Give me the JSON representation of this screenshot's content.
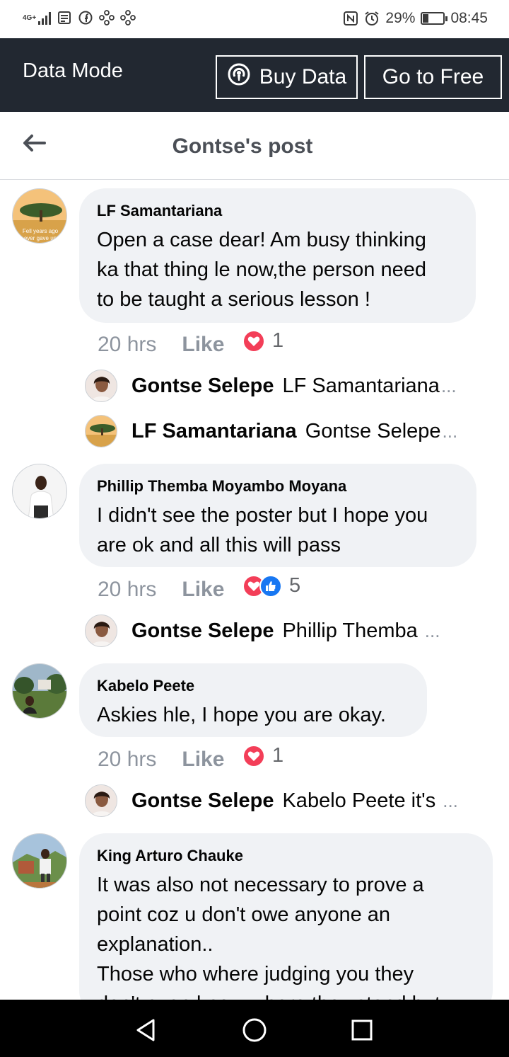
{
  "status_bar": {
    "network": "4G+",
    "battery": "29%",
    "battery_level": 0.29,
    "time": "08:45"
  },
  "data_bar": {
    "title": "Data Mode",
    "buy_label": "Buy Data",
    "free_label": "Go to Free"
  },
  "header": {
    "title": "Gontse's post"
  },
  "comments": [
    {
      "author": "LF Samantariana",
      "text": "Open a case dear! Am busy thinking\nka that thing le now,the person need\nto be taught a serious lesson !",
      "time": "20 hrs",
      "like": "Like",
      "reaction_count": "1",
      "avatar_text": "Fell years ago\never gave up",
      "replies": [
        {
          "name": "Gontse Selepe",
          "text": "LF Samantariana",
          "ellipsis": "..."
        },
        {
          "name": "LF Samantariana",
          "text": "Gontse Selepe",
          "ellipsis": "..."
        }
      ]
    },
    {
      "author": "Phillip Themba Moyambo Moyana",
      "text": "I didn't see the poster but I hope you\nare ok and all this will pass",
      "time": "20 hrs",
      "like": "Like",
      "reaction_count": "5",
      "replies": [
        {
          "name": "Gontse Selepe",
          "text": "Phillip Themba",
          "ellipsis": "..."
        }
      ]
    },
    {
      "author": "Kabelo Peete",
      "text": "Askies hle, I hope you are okay.",
      "time": "20 hrs",
      "like": "Like",
      "reaction_count": "1",
      "replies": [
        {
          "name": "Gontse Selepe",
          "text": "Kabelo Peete it's",
          "ellipsis": "..."
        }
      ]
    },
    {
      "author": "King Arturo Chauke",
      "text": "It was also not necessary to prove a\npoint coz u don't owe anyone an\nexplanation..\nThose who where judging you they\ndon't even know where they stand but"
    }
  ],
  "colors": {
    "data_bar": "#222831",
    "bubble": "#f0f2f5",
    "heart": "#f33e58",
    "like_blue": "#1877f2",
    "meta_gray": "#8d949e"
  },
  "icons": {
    "back": "arrow-left-icon",
    "buy": "broadcast-icon",
    "nav": [
      "back-triangle-icon",
      "home-circle-icon",
      "recents-square-icon"
    ]
  }
}
